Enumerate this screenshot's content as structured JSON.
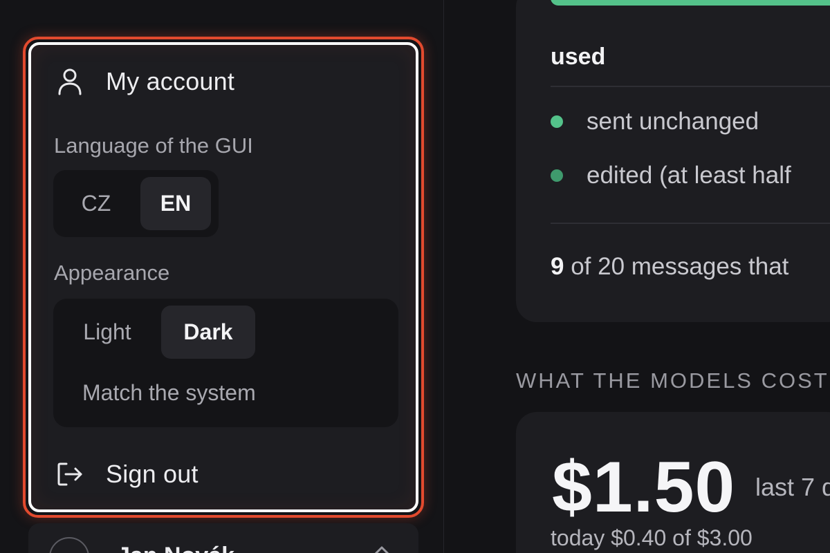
{
  "account_menu": {
    "my_account_label": "My account",
    "language_section_label": "Language of the GUI",
    "language_options": [
      "CZ",
      "EN"
    ],
    "language_selected": "EN",
    "appearance_section_label": "Appearance",
    "appearance_options": [
      "Light",
      "Dark",
      "Match the system"
    ],
    "appearance_selected": "Dark",
    "sign_out_label": "Sign out",
    "highlight_color": "#e24a2e"
  },
  "user": {
    "name": "Jan Novák"
  },
  "usage_card": {
    "heading": "used",
    "legend": [
      {
        "label": "sent unchanged",
        "color": "#54c28a"
      },
      {
        "label": "edited (at least half",
        "color": "#3f9a6d"
      }
    ],
    "count_number": "9",
    "count_text": " of 20 messages that"
  },
  "cost": {
    "section_caption": "WHAT THE MODELS COST",
    "amount": "$1.50",
    "period": "last 7 d",
    "today_line": "today $0.40 of $3.00"
  },
  "colors": {
    "accent_green": "#54c28a",
    "background": "#131316",
    "card": "#1d1d21"
  }
}
